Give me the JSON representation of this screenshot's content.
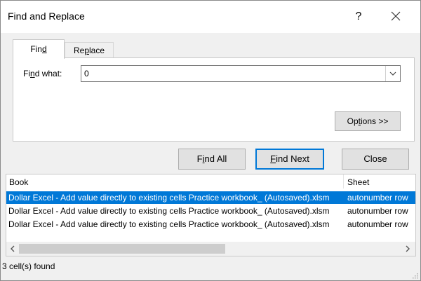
{
  "window": {
    "title": "Find and Replace",
    "help_glyph": "?"
  },
  "tabs": [
    {
      "label_pre": "Fin",
      "label_u": "d",
      "label_post": ""
    },
    {
      "label_pre": "Re",
      "label_u": "p",
      "label_post": "lace"
    }
  ],
  "find": {
    "label_pre": "Fi",
    "label_u": "n",
    "label_post": "d what:",
    "value": "0"
  },
  "options_button": {
    "pre": "Op",
    "u": "t",
    "post": "ions >>"
  },
  "buttons": {
    "find_all": {
      "pre": "F",
      "u": "i",
      "post": "nd All"
    },
    "find_next": {
      "pre": "",
      "u": "F",
      "post": "ind Next"
    },
    "close": "Close"
  },
  "results": {
    "columns": [
      "Book",
      "Sheet"
    ],
    "rows": [
      {
        "book": "Dollar Excel - Add value directly to existing cells Practice workbook_ (Autosaved).xlsm",
        "sheet": "autonumber row"
      },
      {
        "book": "Dollar Excel - Add value directly to existing cells Practice workbook_ (Autosaved).xlsm",
        "sheet": "autonumber row"
      },
      {
        "book": "Dollar Excel - Add value directly to existing cells Practice workbook_ (Autosaved).xlsm",
        "sheet": "autonumber row"
      }
    ],
    "selected_row": 0
  },
  "status": "3 cell(s) found",
  "colors": {
    "accent": "#0078d7",
    "dialog_bg": "#f0f0f0"
  }
}
